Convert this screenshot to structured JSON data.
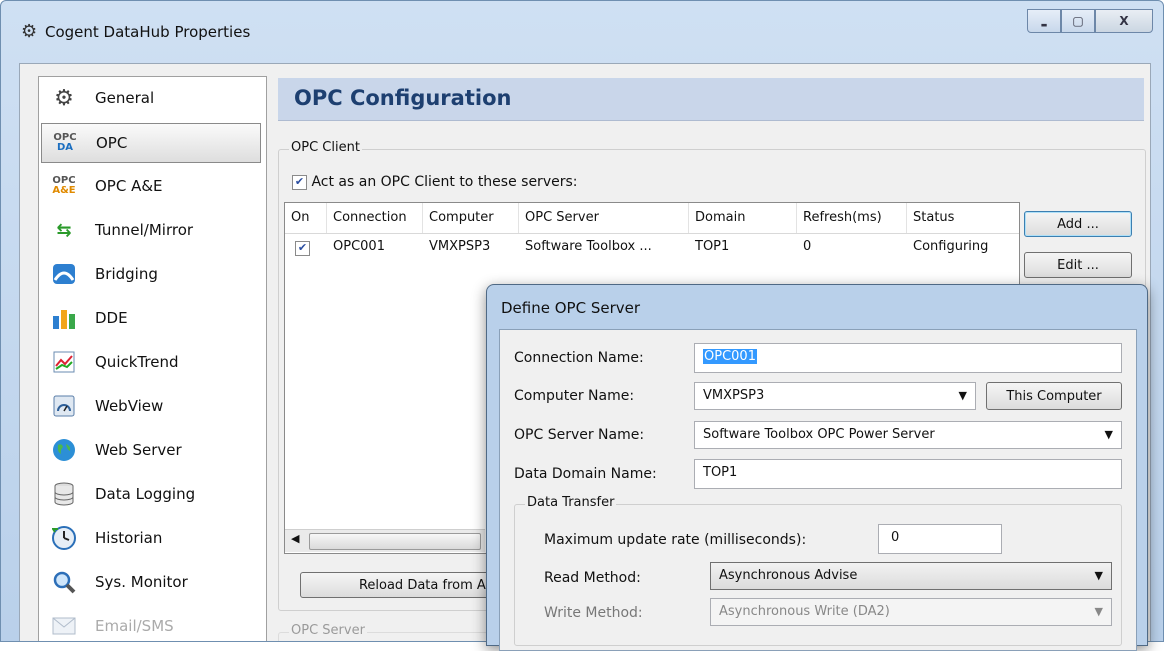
{
  "window": {
    "title": "Cogent DataHub Properties",
    "minimize": "▬",
    "maximize": "▢",
    "close": "X"
  },
  "nav": {
    "items": [
      {
        "label": "General",
        "icon": "gear-icon"
      },
      {
        "label": "OPC",
        "icon": "opc-da-icon",
        "icon_text": "OPC DA",
        "selected": true
      },
      {
        "label": "OPC A&E",
        "icon": "opc-ae-icon",
        "icon_text": "OPC A&E"
      },
      {
        "label": "Tunnel/Mirror",
        "icon": "tunnel-arrows-icon"
      },
      {
        "label": "Bridging",
        "icon": "bridge-icon"
      },
      {
        "label": "DDE",
        "icon": "dde-bars-icon"
      },
      {
        "label": "QuickTrend",
        "icon": "trend-chart-icon"
      },
      {
        "label": "WebView",
        "icon": "gauge-icon"
      },
      {
        "label": "Web Server",
        "icon": "globe-icon"
      },
      {
        "label": "Data Logging",
        "icon": "database-icon"
      },
      {
        "label": "Historian",
        "icon": "clock-icon"
      },
      {
        "label": "Sys. Monitor",
        "icon": "magnifier-icon"
      },
      {
        "label": "Email/SMS",
        "icon": "email-icon"
      }
    ]
  },
  "main": {
    "title": "OPC Configuration",
    "client_group": "OPC Client",
    "act_as_client": "Act as an OPC Client to these servers:",
    "act_checked": true,
    "columns": [
      "On",
      "Connection",
      "Computer",
      "OPC Server",
      "Domain",
      "Refresh(ms)",
      "Status"
    ],
    "rows": [
      {
        "on": true,
        "connection": "OPC001",
        "computer": "VMXPSP3",
        "server": "Software Toolbox ...",
        "domain": "TOP1",
        "refresh": "0",
        "status": "Configuring"
      }
    ],
    "add_button": "Add ...",
    "edit_button": "Edit ...",
    "reload_button": "Reload Data from All",
    "server_group": "OPC Server"
  },
  "dialog": {
    "title": "Define OPC Server",
    "connection_label": "Connection Name:",
    "connection_value": "OPC001",
    "computer_label": "Computer Name:",
    "computer_value": "VMXPSP3",
    "this_computer_button": "This Computer",
    "server_label": "OPC Server Name:",
    "server_value": "Software Toolbox OPC Power Server",
    "domain_label": "Data Domain Name:",
    "domain_value": "TOP1",
    "transfer_group": "Data Transfer",
    "max_rate_label": "Maximum update rate (milliseconds):",
    "max_rate_value": "0",
    "read_label": "Read Method:",
    "read_value": "Asynchronous Advise",
    "write_label": "Write Method:",
    "write_value": "Asynchronous Write (DA2)"
  }
}
